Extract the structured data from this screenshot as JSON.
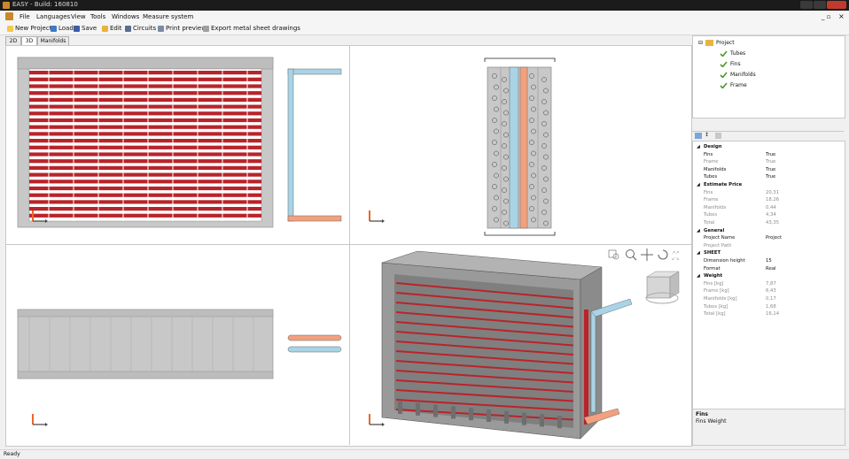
{
  "window": {
    "title": "EASY - Build: 160810"
  },
  "menu": [
    "File",
    "Languages",
    "View",
    "Tools",
    "Windows",
    "Measure system"
  ],
  "toolbar": {
    "new_project": "New Project",
    "load": "Load",
    "save": "Save",
    "edit": "Edit",
    "circuits": "Circuits",
    "print_preview": "Print preview",
    "export": "Export metal sheet drawings"
  },
  "tabs": [
    "2D",
    "3D",
    "Manifolds"
  ],
  "tree": {
    "root": "Project",
    "children": [
      "Tubes",
      "Fins",
      "Manifolds",
      "Frame"
    ]
  },
  "properties": [
    {
      "type": "category",
      "label": "Design"
    },
    {
      "key": "Fins",
      "value": "True",
      "grey": false
    },
    {
      "key": "Frame",
      "value": "True",
      "grey": true
    },
    {
      "key": "Manifolds",
      "value": "True",
      "grey": false
    },
    {
      "key": "Tubes",
      "value": "True",
      "grey": false
    },
    {
      "type": "category",
      "label": "Estimate Price"
    },
    {
      "key": "Fins",
      "value": "20,31",
      "grey": true
    },
    {
      "key": "Frame",
      "value": "18,26",
      "grey": true
    },
    {
      "key": "Manifolds",
      "value": "0,44",
      "grey": true
    },
    {
      "key": "Tubes",
      "value": "4,34",
      "grey": true
    },
    {
      "key": "Total",
      "value": "43,35",
      "grey": true
    },
    {
      "type": "category",
      "label": "General"
    },
    {
      "key": "Project Name",
      "value": "Project",
      "grey": false
    },
    {
      "key": "Project Path",
      "value": "",
      "grey": true
    },
    {
      "type": "category",
      "label": "SHEET"
    },
    {
      "key": "Dimension height",
      "value": "15",
      "grey": false
    },
    {
      "key": "Format",
      "value": "Real",
      "grey": false
    },
    {
      "type": "category",
      "label": "Weight"
    },
    {
      "key": "Fins [kg]",
      "value": "7,87",
      "grey": true
    },
    {
      "key": "Frame [kg]",
      "value": "6,43",
      "grey": true
    },
    {
      "key": "Manifolds [kg]",
      "value": "0,17",
      "grey": true
    },
    {
      "key": "Tubes [kg]",
      "value": "1,68",
      "grey": true
    },
    {
      "key": "Total [kg]",
      "value": "16,14",
      "grey": true
    }
  ],
  "description": {
    "title": "Fins",
    "text": "Fins Weight"
  },
  "status": "Ready",
  "colors": {
    "tube_red": "#b8242a",
    "manifold_blue": "#a9d3e6",
    "manifold_orange": "#f2a07e",
    "frame_grey": "#c8c8c8",
    "accent_orange": "#e8672a"
  },
  "icons": [
    "new-project-icon",
    "load-icon",
    "save-icon",
    "edit-icon",
    "circuits-icon",
    "print-preview-icon",
    "export-icon",
    "zoom-window-icon",
    "zoom-icon",
    "pan-icon",
    "rotate-icon",
    "fit-icon",
    "view-cube-icon",
    "axis-icon"
  ]
}
